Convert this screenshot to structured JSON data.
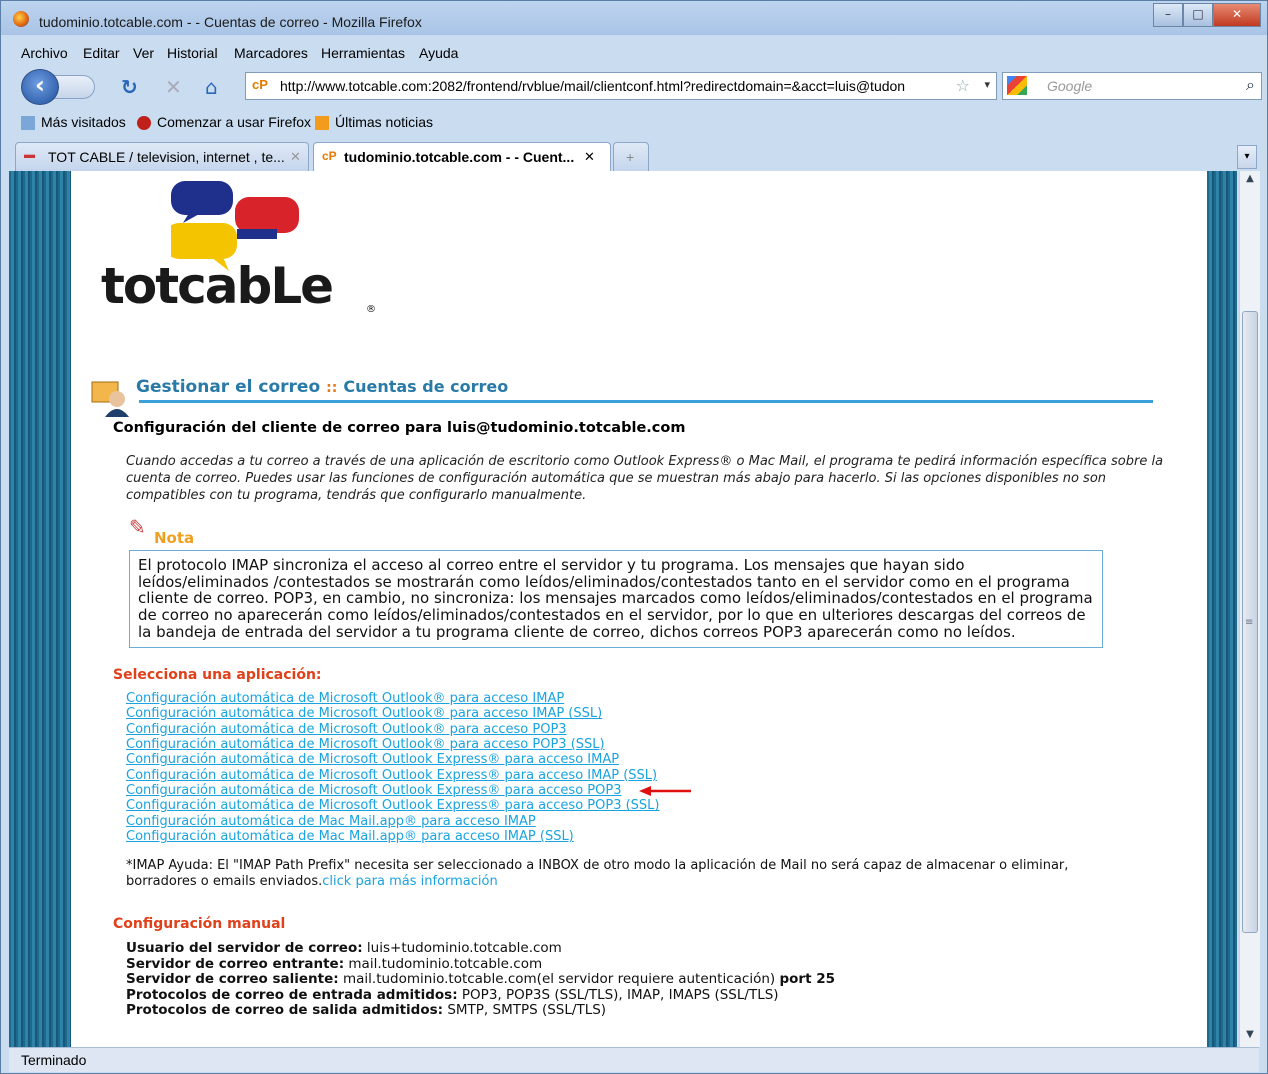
{
  "window": {
    "title": "tudominio.totcable.com - - Cuentas de correo - Mozilla Firefox",
    "controls": {
      "minimize": "–",
      "maximize": "□",
      "close": "✕"
    }
  },
  "menubar": [
    "Archivo",
    "Editar",
    "Ver",
    "Historial",
    "Marcadores",
    "Herramientas",
    "Ayuda"
  ],
  "navbar": {
    "url_prefix": "cP",
    "url": "http://www.totcable.com:2082/frontend/rvblue/mail/clientconf.html?redirectdomain=&acct=luis@tudon",
    "search_placeholder": "Google"
  },
  "bookmarks": [
    "Más visitados",
    "Comenzar a usar Firefox",
    "Últimas noticias"
  ],
  "tabs": [
    {
      "label": "TOT CABLE / television, internet , te...",
      "active": false
    },
    {
      "label": "tudominio.totcable.com - - Cuent...",
      "active": true
    },
    {
      "label": "+",
      "active": false
    }
  ],
  "logo": {
    "text": "totcabLe",
    "registered": "®"
  },
  "page": {
    "breadcrumb_main": "Gestionar el correo",
    "breadcrumb_sep": "::",
    "breadcrumb_sub": "Cuentas de correo",
    "title": "Configuración del cliente de correo para luis@tudominio.totcable.com",
    "intro": "Cuando accedas a tu correo a través de una aplicación de escritorio como Outlook Express® o Mac Mail, el programa te pedirá información específica sobre la cuenta de correo. Puedes usar las funciones de configuración automática que se muestran más abajo para hacerlo. Si las opciones disponibles no son compatibles con tu programa, tendrás que configurarlo manualmente.",
    "note_label": "Nota",
    "note_text": "El protocolo IMAP sincroniza el acceso al correo entre el servidor y tu programa. Los mensajes que hayan sido leídos/eliminados /contestados se mostrarán como leídos/eliminados/contestados tanto en el servidor como en el programa cliente de correo. POP3, en cambio, no sincroniza: los mensajes marcados como leídos/eliminados/contestados en el programa de correo no aparecerán como leídos/eliminados/contestados en el servidor, por lo que en ulteriores descargas del correos de la bandeja de entrada del servidor a tu programa cliente de correo, dichos correos POP3 aparecerán como no leídos.",
    "select_heading": "Selecciona una aplicación:",
    "links": [
      "Configuración automática de Microsoft Outlook® para acceso IMAP",
      "Configuración automática de Microsoft Outlook® para acceso IMAP (SSL)",
      "Configuración automática de Microsoft Outlook® para acceso POP3",
      "Configuración automática de Microsoft Outlook® para acceso POP3 (SSL)",
      "Configuración automática de Microsoft Outlook Express® para acceso IMAP",
      "Configuración automática de Microsoft Outlook Express® para acceso IMAP (SSL)",
      "Configuración automática de Microsoft Outlook Express® para acceso POP3",
      "Configuración automática de Microsoft Outlook Express® para acceso POP3 (SSL)",
      "Configuración automática de Mac Mail.app® para acceso IMAP",
      "Configuración automática de Mac Mail.app® para acceso IMAP (SSL)"
    ],
    "imap_help": "*IMAP Ayuda: El \"IMAP Path Prefix\" necesita ser seleccionado a INBOX de otro modo la aplicación de Mail no será capaz de almacenar o eliminar, borradores o emails enviados.",
    "imap_link": "click para más información",
    "manual_heading": "Configuración manual",
    "manual": {
      "user_label": "Usuario del servidor de correo:",
      "user_value": " luis+tudominio.totcable.com",
      "in_label": "Servidor de correo entrante:",
      "in_value": " mail.tudominio.totcable.com",
      "out_label": "Servidor de correo saliente:",
      "out_value": " mail.tudominio.totcable.com(el servidor requiere autenticación) ",
      "out_port": "port 25",
      "inproto_label": "Protocolos de correo de entrada admitidos:",
      "inproto_value": " POP3, POP3S (SSL/TLS), IMAP, IMAPS (SSL/TLS)",
      "outproto_label": "Protocolos de correo de salida admitidos:",
      "outproto_value": " SMTP, SMTPS (SSL/TLS)"
    }
  },
  "status": "Terminado",
  "colors": {
    "link": "#1aa3e0",
    "heading_blue": "#2a7aa8",
    "accent_orange": "#e0401a",
    "arrow_red": "#e01010"
  }
}
